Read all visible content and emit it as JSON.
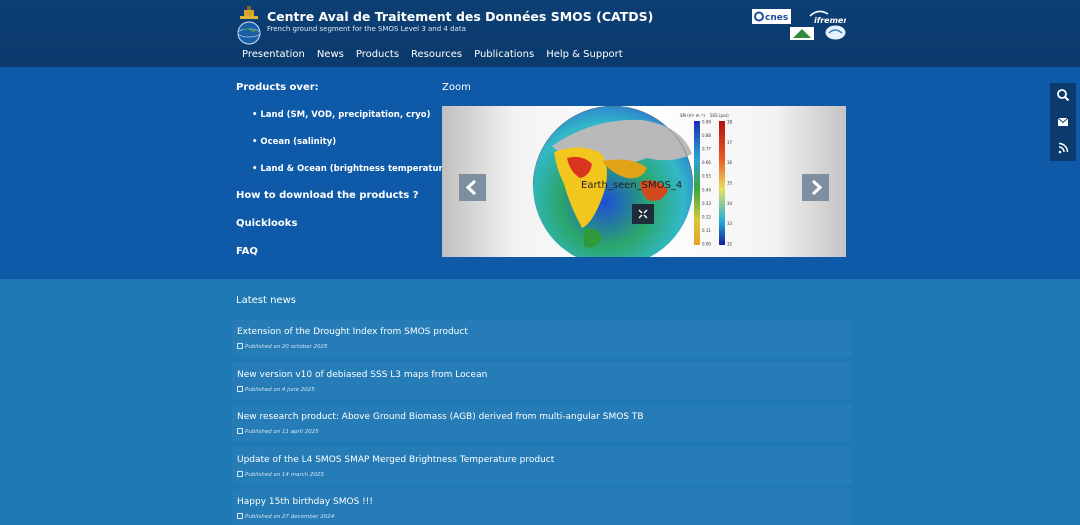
{
  "header": {
    "title": "Centre Aval de Traitement des Données SMOS (CATDS)",
    "subtitle": "French ground segment for the SMOS Level 3 and 4 data",
    "partners": [
      "cnes",
      "ifremer"
    ]
  },
  "nav": [
    {
      "label": "Presentation"
    },
    {
      "label": "News"
    },
    {
      "label": "Products"
    },
    {
      "label": "Resources"
    },
    {
      "label": "Publications"
    },
    {
      "label": "Help & Support"
    }
  ],
  "products": {
    "heading": "Products over:",
    "items": [
      "• Land (SM, VOD, precipitation, cryo)",
      "• Ocean (salinity)",
      "• Land & Ocean (brightness temperature)"
    ],
    "links": [
      "How to download the products ?",
      "Quicklooks",
      "FAQ"
    ]
  },
  "zoom": {
    "title": "Zoom",
    "slide_caption": "Earth_seen_SMOS_4",
    "colorbar_sm_label": "SM (m³ m⁻³)",
    "colorbar_sss_label": "SSS (pss)",
    "colorbar_sm_ticks": [
      "0.99",
      "0.88",
      "0.77",
      "0.66",
      "0.55",
      "0.44",
      "0.33",
      "0.22",
      "0.11",
      "0.00"
    ],
    "colorbar_sss_ticks": [
      "38",
      "37",
      "36",
      "35",
      "34",
      "33",
      "32"
    ]
  },
  "news": {
    "heading": "Latest news",
    "items": [
      {
        "title": "Extension of the Drought Index from SMOS product",
        "date": "Published on 20 october 2025"
      },
      {
        "title": "New version v10 of debiased SSS L3 maps from Locean",
        "date": "Published on 4 june 2025"
      },
      {
        "title": "New research product: Above Ground Biomass (AGB) derived from multi-angular SMOS TB",
        "date": "Published on 11 april 2025"
      },
      {
        "title": "Update of the L4 SMOS SMAP Merged Brightness Temperature product",
        "date": "Published on 14 march 2025"
      },
      {
        "title": "Happy 15th birthday SMOS !!!",
        "date": "Published on 27 december 2024"
      }
    ]
  },
  "colors": {
    "header_bg": "#0b3a6c",
    "hero_bg": "#0f5aa8",
    "news_bg": "#1e78b4"
  },
  "icons": [
    "search-icon",
    "email-icon",
    "rss-icon",
    "chevron-left-icon",
    "chevron-right-icon",
    "expand-icon"
  ]
}
